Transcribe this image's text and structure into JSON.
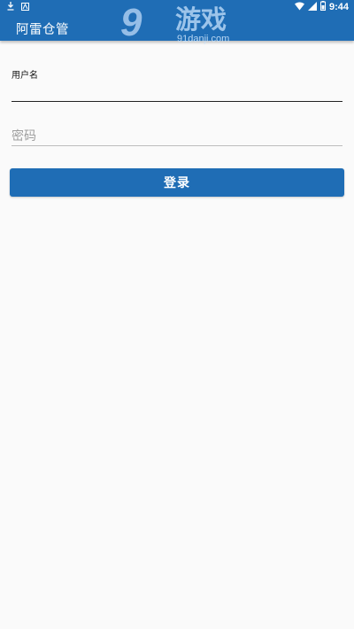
{
  "status_bar": {
    "time": "9:44",
    "left_icons": [
      "download-icon",
      "app-notification-icon"
    ],
    "right_icons": [
      "wifi-icon",
      "cell-signal-icon",
      "battery-icon"
    ]
  },
  "app_bar": {
    "title": "阿雷仓管",
    "background_color": "#1f6db5"
  },
  "watermark": {
    "logo_text": "9",
    "brand_text": "游戏",
    "url": "91danji.com"
  },
  "login_form": {
    "username": {
      "label": "用户名",
      "value": ""
    },
    "password": {
      "placeholder": "密码",
      "value": ""
    },
    "submit_label": "登录",
    "accent_color": "#1f6db5"
  }
}
